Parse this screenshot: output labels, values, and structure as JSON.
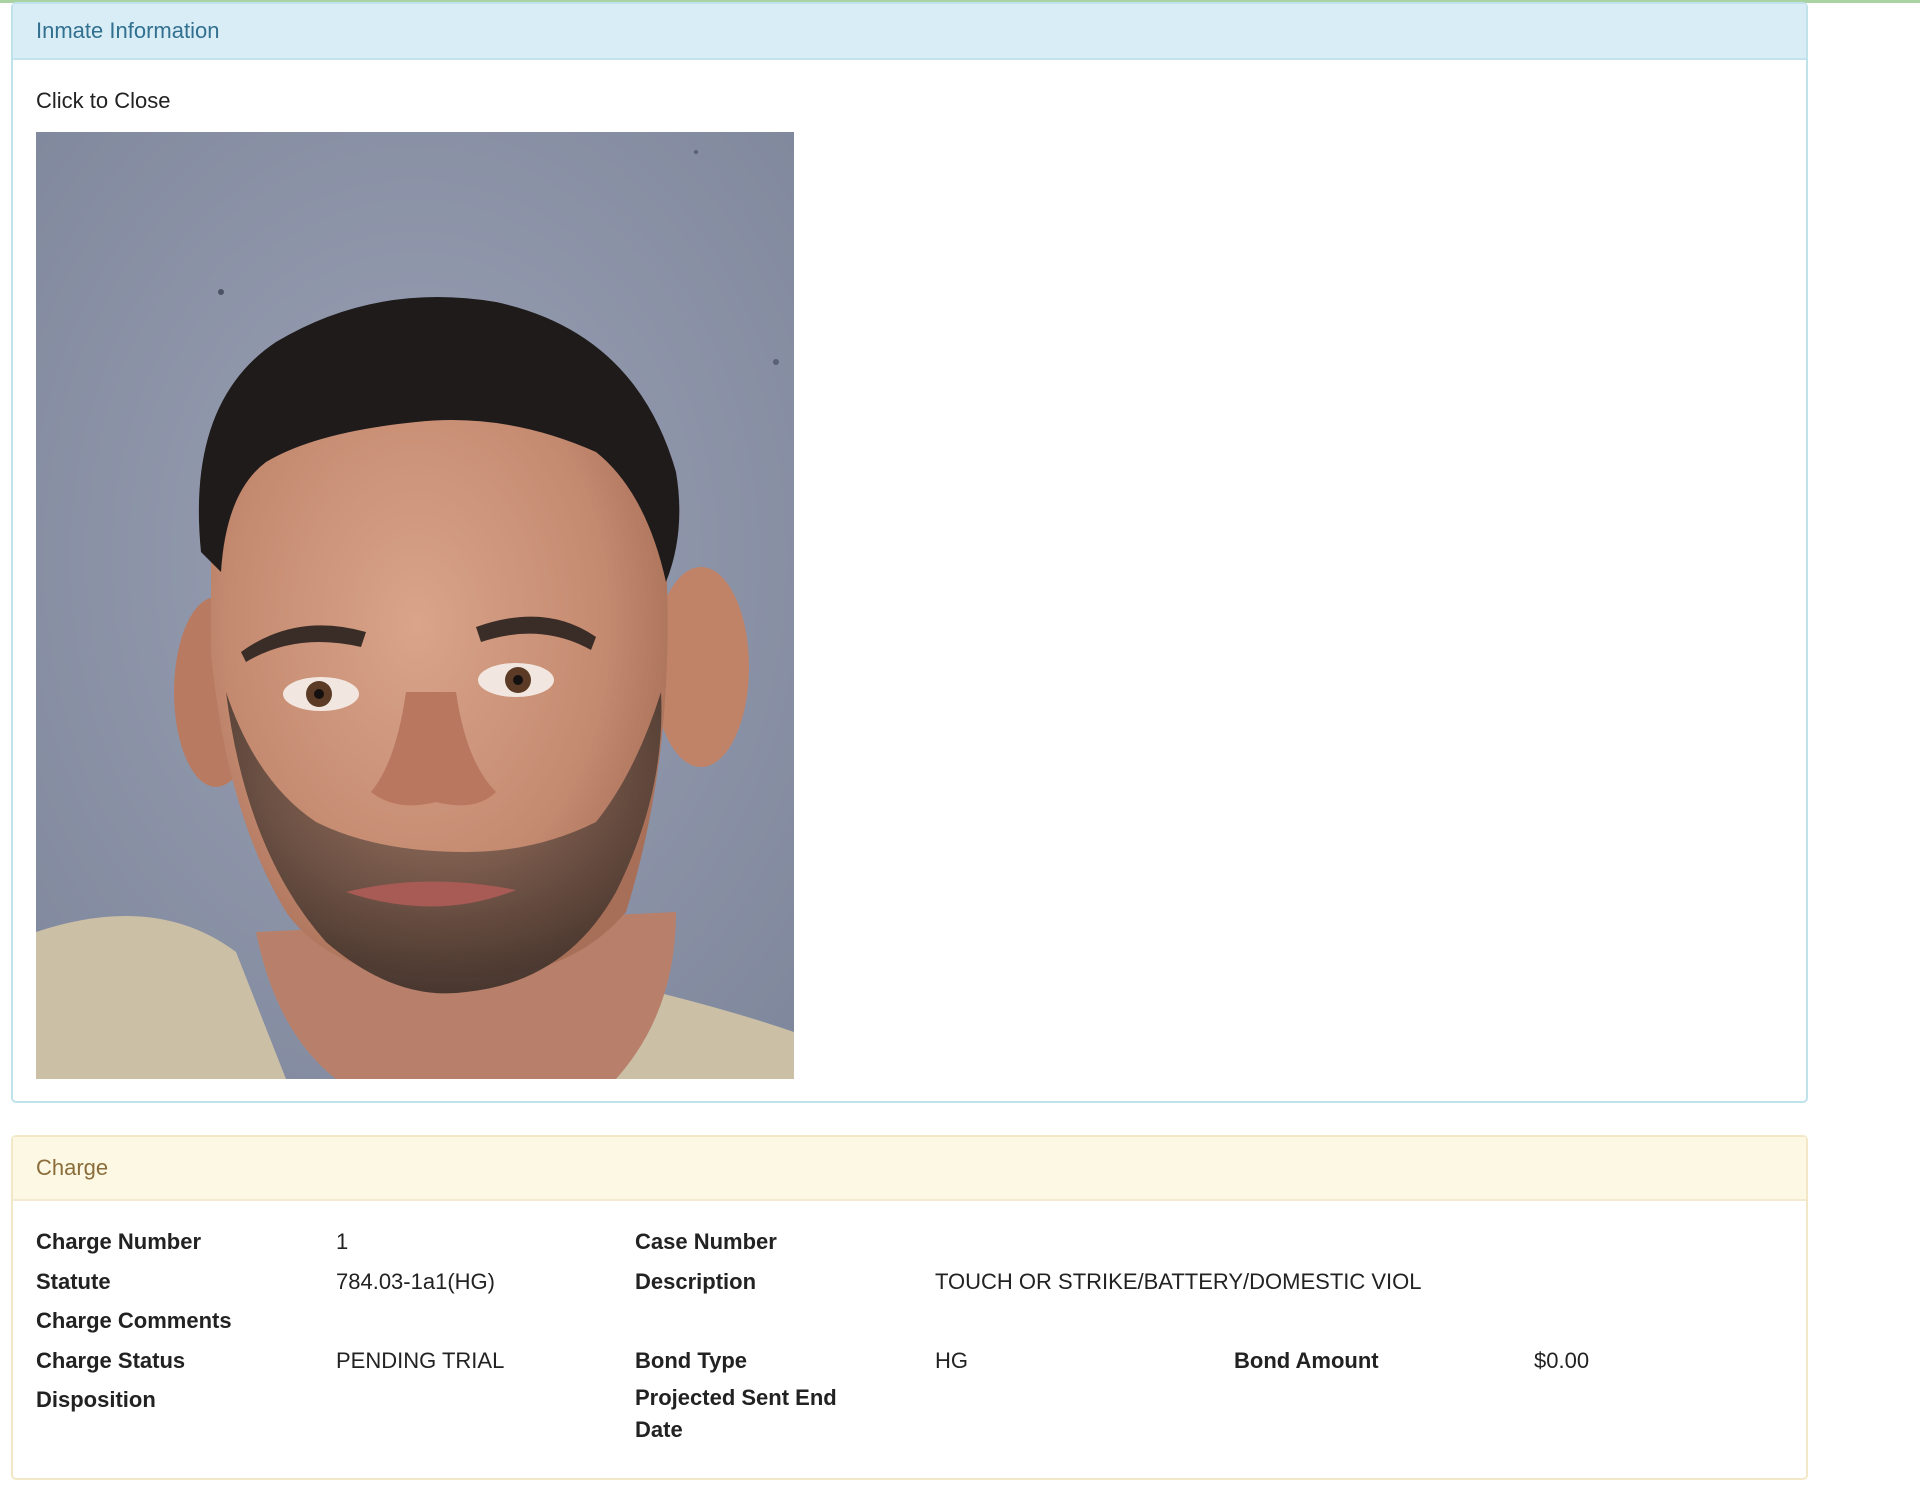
{
  "inmate_panel": {
    "title": "Inmate Information",
    "close_text": "Click to Close",
    "photo_icon": "mugshot-photo"
  },
  "charge_panel": {
    "title": "Charge",
    "fields": {
      "charge_number": {
        "label": "Charge Number",
        "value": "1"
      },
      "case_number": {
        "label": "Case Number",
        "value": ""
      },
      "statute": {
        "label": "Statute",
        "value": "784.03-1a1(HG)"
      },
      "description": {
        "label": "Description",
        "value": "TOUCH OR STRIKE/BATTERY/DOMESTIC VIOL"
      },
      "charge_comments": {
        "label": "Charge Comments",
        "value": ""
      },
      "charge_status": {
        "label": "Charge Status",
        "value": "PENDING TRIAL"
      },
      "bond_type": {
        "label": "Bond Type",
        "value": "HG"
      },
      "bond_amount": {
        "label": "Bond Amount",
        "value": "$0.00"
      },
      "disposition": {
        "label": "Disposition",
        "value": ""
      },
      "projected_sent_end_date": {
        "label": "Projected Sent End Date",
        "value": ""
      }
    }
  },
  "colors": {
    "info_heading_bg": "#d9edf7",
    "info_heading_text": "#31708f",
    "warning_heading_bg": "#fcf8e3",
    "warning_heading_text": "#8a6d3b",
    "photo_background": "#8e96ab",
    "uniform": "#cfc2a8"
  }
}
